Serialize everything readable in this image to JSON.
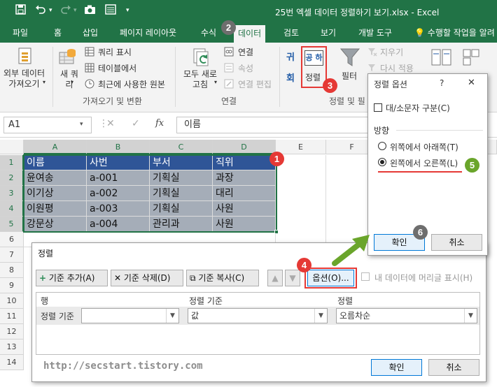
{
  "titlebar": {
    "title": "25번 엑셀 데이터 정렬하기 보기.xlsx - Excel",
    "qat_icons": [
      "save-icon",
      "undo-icon",
      "redo-icon",
      "camera-icon",
      "form-icon",
      "customize-icon"
    ]
  },
  "tabs": [
    {
      "label": "파일"
    },
    {
      "label": "홈"
    },
    {
      "label": "삽입"
    },
    {
      "label": "페이지 레이아웃"
    },
    {
      "label": "수식"
    },
    {
      "label": "데이터",
      "active": true
    },
    {
      "label": "검토"
    },
    {
      "label": "보기"
    },
    {
      "label": "개발 도구"
    }
  ],
  "tellme": "수행할 작업을 알려",
  "ribbon": {
    "get_external": "외부 데이터\n가져오기",
    "new_query": "새 쿼\n리",
    "show_query": "쿼리 표시",
    "from_table": "테이블에서",
    "recent_sources": "최근에 사용한 원본",
    "group_get_transform": "가져오기 및 변환",
    "refresh_all": "모두 새로\n고침",
    "connections": "연결",
    "properties": "속성",
    "edit_links": "연결 편집",
    "group_connections": "연결",
    "sort_az": "귀",
    "sort_za": "회",
    "sort": "정렬",
    "sort_icon_text": "공 하",
    "filter": "필터",
    "clear": "지우기",
    "reapply": "다시 적용",
    "group_sort_filter": "정렬 및 필"
  },
  "formula_bar": {
    "name_box": "A1",
    "fx": "fx",
    "content": "이름"
  },
  "sheet": {
    "columns": [
      "A",
      "B",
      "C",
      "D",
      "E",
      "F"
    ],
    "rows": [
      "1",
      "2",
      "3",
      "4",
      "5",
      "6",
      "7",
      "8",
      "9",
      "10",
      "11",
      "12",
      "13",
      "14"
    ],
    "data": [
      [
        "이름",
        "사번",
        "부서",
        "직위"
      ],
      [
        "윤여송",
        "a-001",
        "기획실",
        "과장"
      ],
      [
        "이기상",
        "a-002",
        "기획실",
        "대리"
      ],
      [
        "이원평",
        "a-003",
        "기획실",
        "사원"
      ],
      [
        "강문상",
        "a-004",
        "관리과",
        "사원"
      ]
    ]
  },
  "sort_dialog": {
    "title": "정렬",
    "add_level": "기준 추가(A)",
    "delete_level": "기준 삭제(D)",
    "copy_level": "기준 복사(C)",
    "options": "옵션(O)...",
    "header_checkbox": "내 데이터에 머리글 표시(H)",
    "col_header": "행",
    "sort_on_header": "정렬 기준",
    "order_header": "정렬",
    "row_label": "정렬 기준",
    "sort_on_value": "값",
    "order_value": "오름차순",
    "ok": "확인",
    "cancel": "취소"
  },
  "options_dialog": {
    "title": "정렬 옵션",
    "help": "?",
    "case_sensitive": "대/소문자 구분(C)",
    "orientation": "방향",
    "top_to_bottom": "위쪽에서 아래쪽(T)",
    "left_to_right": "왼쪽에서 오른쪽(L)",
    "ok": "확인",
    "cancel": "취소"
  },
  "badges": [
    "1",
    "2",
    "3",
    "4",
    "5",
    "6"
  ],
  "watermark": "http://secstart.tistory.com",
  "colors": {
    "excel_green": "#217346",
    "header_fill": "#2f5597",
    "body_fill": "#a5adb8",
    "highlight_red": "#e53935",
    "badge_gray": "#6e6e6e",
    "badge_green": "#6aa52b"
  }
}
